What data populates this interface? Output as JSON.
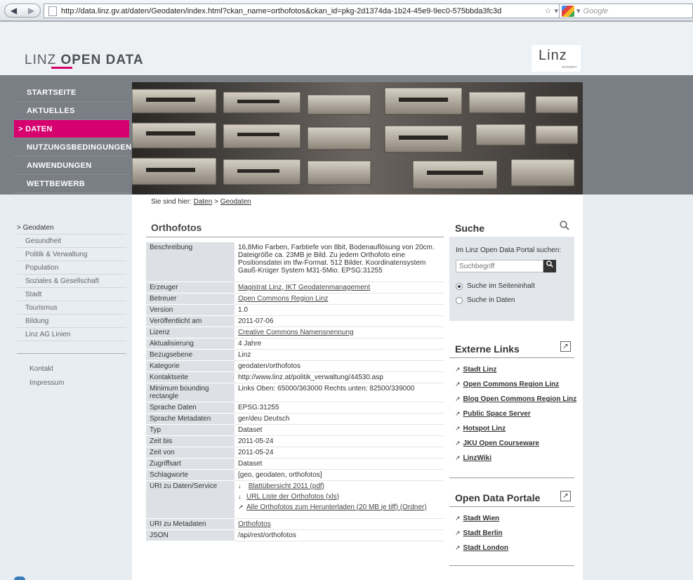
{
  "browser": {
    "url": "http://data.linz.gv.at/daten/Geodaten/index.html?ckan_name=orthofotos&ckan_id=pkg-2d1374da-1b24-45e9-9ec0-575bbda3fc3d",
    "search_engine": "Google",
    "back_icon": "arrow-left",
    "forward_icon": "arrow-right",
    "reload_glyph": "C"
  },
  "header": {
    "logo_prefix": "LINZ",
    "logo_bold": "OPEN DATA",
    "linz_mark": "Linz",
    "linz_mark_sub": "verändert",
    "accent_color": "#d6006f"
  },
  "nav": {
    "items": [
      {
        "label": "STARTSEITE"
      },
      {
        "label": "AKTUELLES"
      },
      {
        "label": "DATEN"
      },
      {
        "label": "NUTZUNGSBEDINGUNGEN"
      },
      {
        "label": "ANWENDUNGEN"
      },
      {
        "label": "WETTBEWERB"
      }
    ],
    "active_index": 2,
    "active_marker": ">"
  },
  "breadcrumb": {
    "prefix": "Sie sind hier:",
    "items": [
      "Daten",
      "Geodaten"
    ],
    "separator": ">"
  },
  "sub_nav": {
    "head": "Geodaten",
    "head_marker": ">",
    "items": [
      "Gesundheit",
      "Politik & Verwaltung",
      "Population",
      "Soziales & Gesellschaft",
      "Stadt",
      "Tourismus",
      "Bildung",
      "Linz AG Linien"
    ],
    "extra": [
      "Kontakt",
      "Impressum"
    ]
  },
  "main": {
    "title": "Orthofotos",
    "rows": [
      {
        "key": "Beschreibung",
        "value": "16,8Mio Farben, Farbtiefe von 8bit, Bodenauflösung von 20cm. Dateigröße ca. 23MB je Bild. Zu jedem Orthofoto eine Positionsdatei im tfw-Format. 512 Bilder. Koordinatensystem Gauß-Krüger System M31-5Mio. EPSG:31255"
      },
      {
        "key": "Erzeuger",
        "value": "Magistrat Linz, IKT Geodatenmanagement",
        "link": true
      },
      {
        "key": "Betreuer",
        "value": "Open Commons Region Linz",
        "link": true
      },
      {
        "key": "Version",
        "value": "1.0"
      },
      {
        "key": "Veröffentlicht am",
        "value": "2011-07-06"
      },
      {
        "key": "Lizenz",
        "value": "Creative Commons Namensnennung",
        "link": true
      },
      {
        "key": "Aktualisierung",
        "value": "4 Jahre"
      },
      {
        "key": "Bezugsebene",
        "value": "Linz"
      },
      {
        "key": "Kategorie",
        "value": "geodaten/orthofotos"
      },
      {
        "key": "Kontaktseite",
        "value": "http://www.linz.at/politik_verwaltung/44530.asp"
      },
      {
        "key": "Minimum bounding rectangle",
        "value": "Links Oben: 65000/363000 Rechts unten: 82500/339000"
      },
      {
        "key": "Sprache Daten",
        "value": "EPSG:31255"
      },
      {
        "key": "Sprache Metadaten",
        "value": "ger/deu Deutsch"
      },
      {
        "key": "Typ",
        "value": "Dataset"
      },
      {
        "key": "Zeit bis",
        "value": "2011-05-24"
      },
      {
        "key": "Zeit von",
        "value": "2011-05-24"
      },
      {
        "key": "Zugriffsart",
        "value": "Dataset"
      },
      {
        "key": "Schlagworte",
        "value": "[geo, geodaten, orthofotos]"
      }
    ],
    "uri_key": "URI zu Daten/Service",
    "uri_links": [
      {
        "arrow": "↓",
        "label": "Blattübersicht 2011 (pdf)"
      },
      {
        "arrow": "↓",
        "label": "URL Liste der Orthofotos (xls)"
      },
      {
        "arrow": "↗",
        "label": "Alle Orthofotos zum Herunterladen (20 MB je tiff) (Ordner)"
      }
    ],
    "meta_key": "URI zu Metadaten",
    "meta_value": "Orthofotos",
    "json_key": "JSON",
    "json_value": "/api/rest/orthofotos"
  },
  "search": {
    "title": "Suche",
    "label": "Im Linz Open Data Portal suchen:",
    "placeholder": "Suchbegriff",
    "options": [
      {
        "label": "Suche im Seiteninhalt",
        "selected": true
      },
      {
        "label": "Suche in Daten",
        "selected": false
      }
    ]
  },
  "external_links": {
    "title": "Externe Links",
    "items": [
      "Stadt Linz",
      "Open Commons Region Linz",
      "Blog Open Commons Region Linz",
      "Public Space Server",
      "Hotspot Linz",
      "JKU Open Courseware",
      "LinzWiki"
    ]
  },
  "portals": {
    "title": "Open Data Portale",
    "items": [
      "Stadt Wien",
      "Stadt Berlin",
      "Stadt London"
    ]
  }
}
